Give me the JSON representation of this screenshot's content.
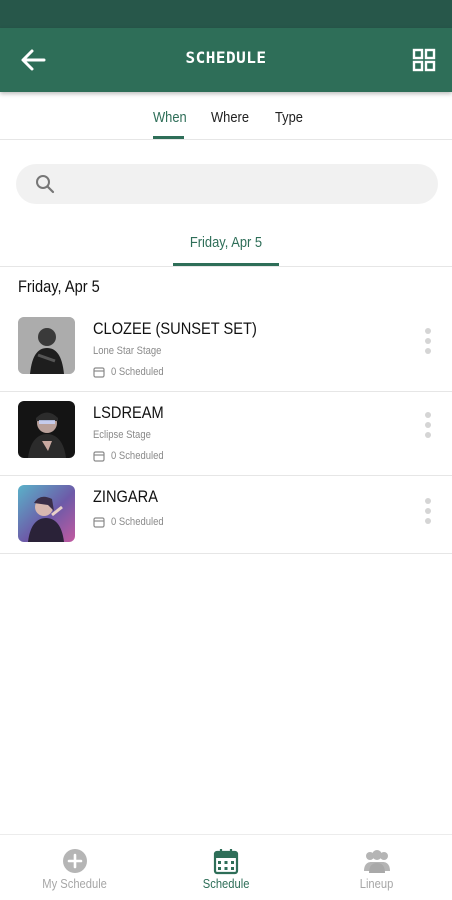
{
  "header": {
    "title": "SCHEDULE",
    "back_icon": "back-arrow-icon",
    "view_icon": "grid-view-icon"
  },
  "colors": {
    "primary": "#2e6e58",
    "status_bar": "#27574a",
    "muted": "#8a8a8a",
    "inactive": "#a7a7a7"
  },
  "filter_tabs": [
    {
      "label": "When",
      "active": true
    },
    {
      "label": "Where",
      "active": false
    },
    {
      "label": "Type",
      "active": false
    }
  ],
  "search": {
    "placeholder": "",
    "value": ""
  },
  "date_tabs": [
    {
      "label": "Friday, Apr 5",
      "active": true
    }
  ],
  "section": {
    "title": "Friday, Apr 5"
  },
  "events": [
    {
      "artist": "CLOZEE (SUNSET SET)",
      "stage": "Lone Star Stage",
      "scheduled": "0 Scheduled"
    },
    {
      "artist": "LSDREAM",
      "stage": "Eclipse Stage",
      "scheduled": "0 Scheduled"
    },
    {
      "artist": "ZINGARA",
      "stage": "",
      "scheduled": "0 Scheduled"
    }
  ],
  "bottom_nav": [
    {
      "label": "My Schedule",
      "icon": "add-circle-icon",
      "active": false
    },
    {
      "label": "Schedule",
      "icon": "calendar-icon",
      "active": true
    },
    {
      "label": "Lineup",
      "icon": "group-icon",
      "active": false
    }
  ]
}
